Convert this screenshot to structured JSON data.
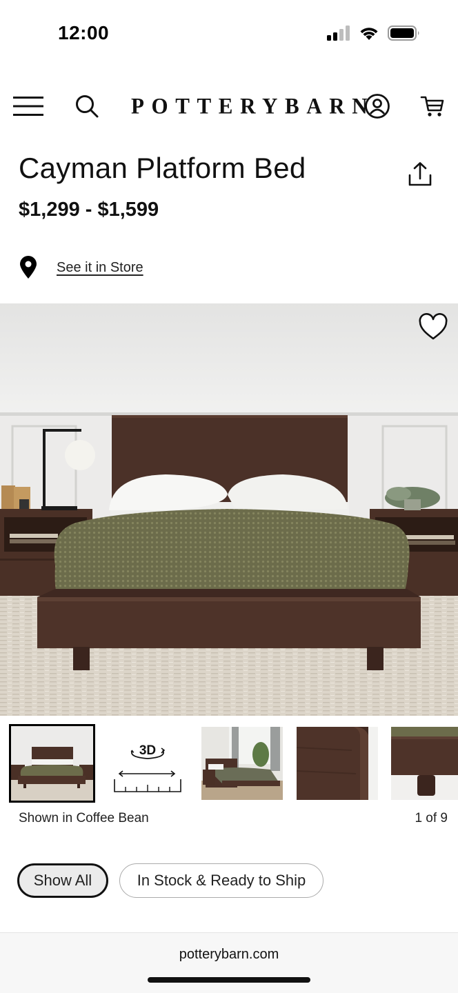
{
  "status_bar": {
    "time": "12:00",
    "icons": [
      "cellular-signal-icon",
      "wifi-icon",
      "battery-icon"
    ]
  },
  "header": {
    "menu_icon": "hamburger-menu-icon",
    "search_icon": "search-icon",
    "logo": "POTTERYBARN",
    "account_icon": "account-icon",
    "cart_icon": "cart-icon"
  },
  "product": {
    "title": "Cayman Platform Bed",
    "price": "$1,299 - $1,599",
    "store_link": "See it in Store",
    "share_icon": "share-icon",
    "favorite_icon": "heart-icon"
  },
  "gallery": {
    "thumbnail_3d_label": "3D",
    "shown_in": "Shown in Coffee Bean",
    "counter": "1 of 9",
    "thumbnails": [
      "bed-front-view",
      "3d-view",
      "bed-room-view",
      "wood-corner-detail",
      "leg-detail"
    ]
  },
  "filters": {
    "show_all": "Show All",
    "in_stock": "In Stock & Ready to Ship"
  },
  "browser": {
    "url": "potterybarn.com"
  },
  "colors": {
    "wood": "#4a3026",
    "blanket": "#6b6c4a",
    "wall": "#e9e9e8",
    "rug": "#d9d1c4"
  }
}
